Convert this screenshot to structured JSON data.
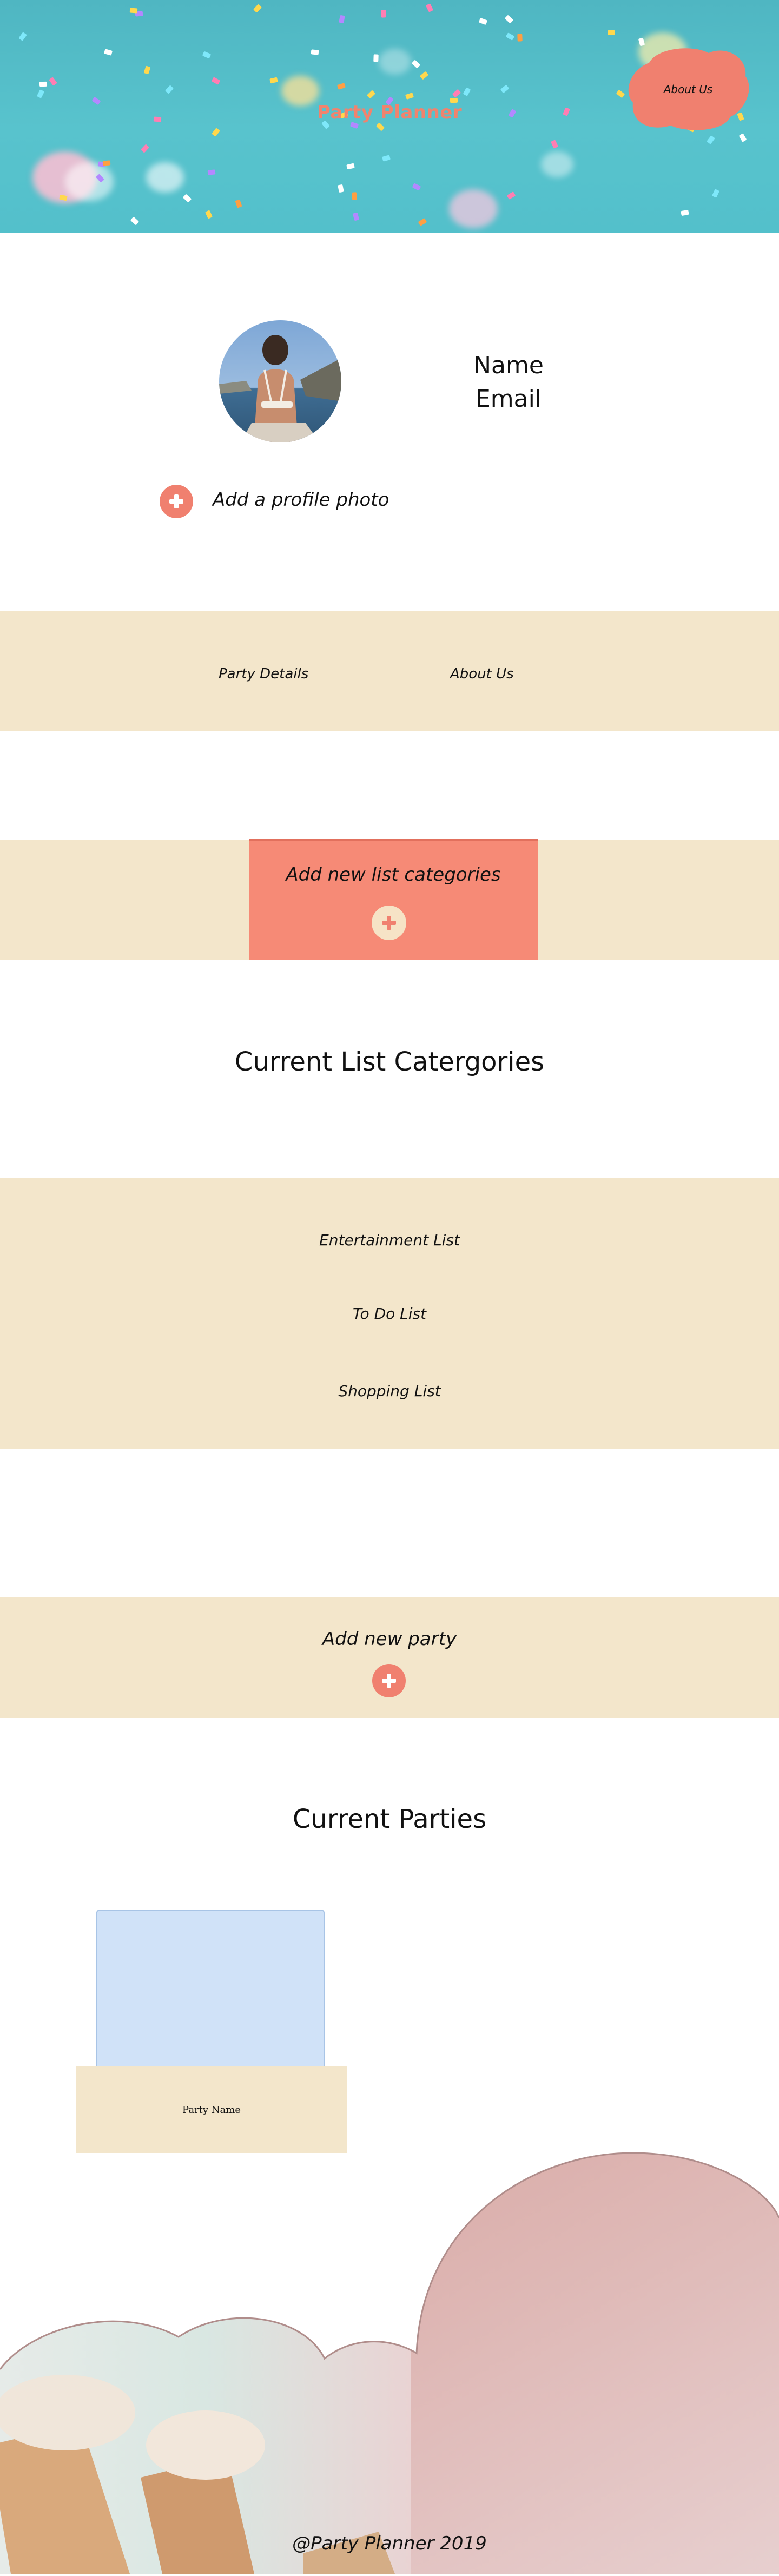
{
  "header": {
    "site_title": "Party Planner",
    "about_button_label": "About Us"
  },
  "profile": {
    "name_label": "Name",
    "email_label": "Email",
    "add_photo_label": "Add a profile photo"
  },
  "nav": {
    "items": [
      {
        "label": "Party Details"
      },
      {
        "label": "About Us"
      }
    ]
  },
  "categories": {
    "add_label": "Add new list categories",
    "heading": "Current List Catergories",
    "lists": [
      {
        "label": "Entertainment List"
      },
      {
        "label": "To Do List"
      },
      {
        "label": "Shopping List"
      }
    ]
  },
  "parties": {
    "add_label": "Add new party",
    "heading": "Current Parties",
    "cards": [
      {
        "name": "Party Name"
      }
    ]
  },
  "footer": {
    "text": "@Party Planner 2019"
  },
  "colors": {
    "accent_coral": "#f0806f",
    "band_cream": "#f3e6cb",
    "hero_teal": "#53c0cb",
    "card_blue": "#d0e2f8",
    "footer_pink": "#d9a9a6"
  },
  "icons": {
    "add_photo": "plus-circle-icon",
    "add_category": "plus-circle-icon",
    "add_party": "plus-circle-icon"
  }
}
